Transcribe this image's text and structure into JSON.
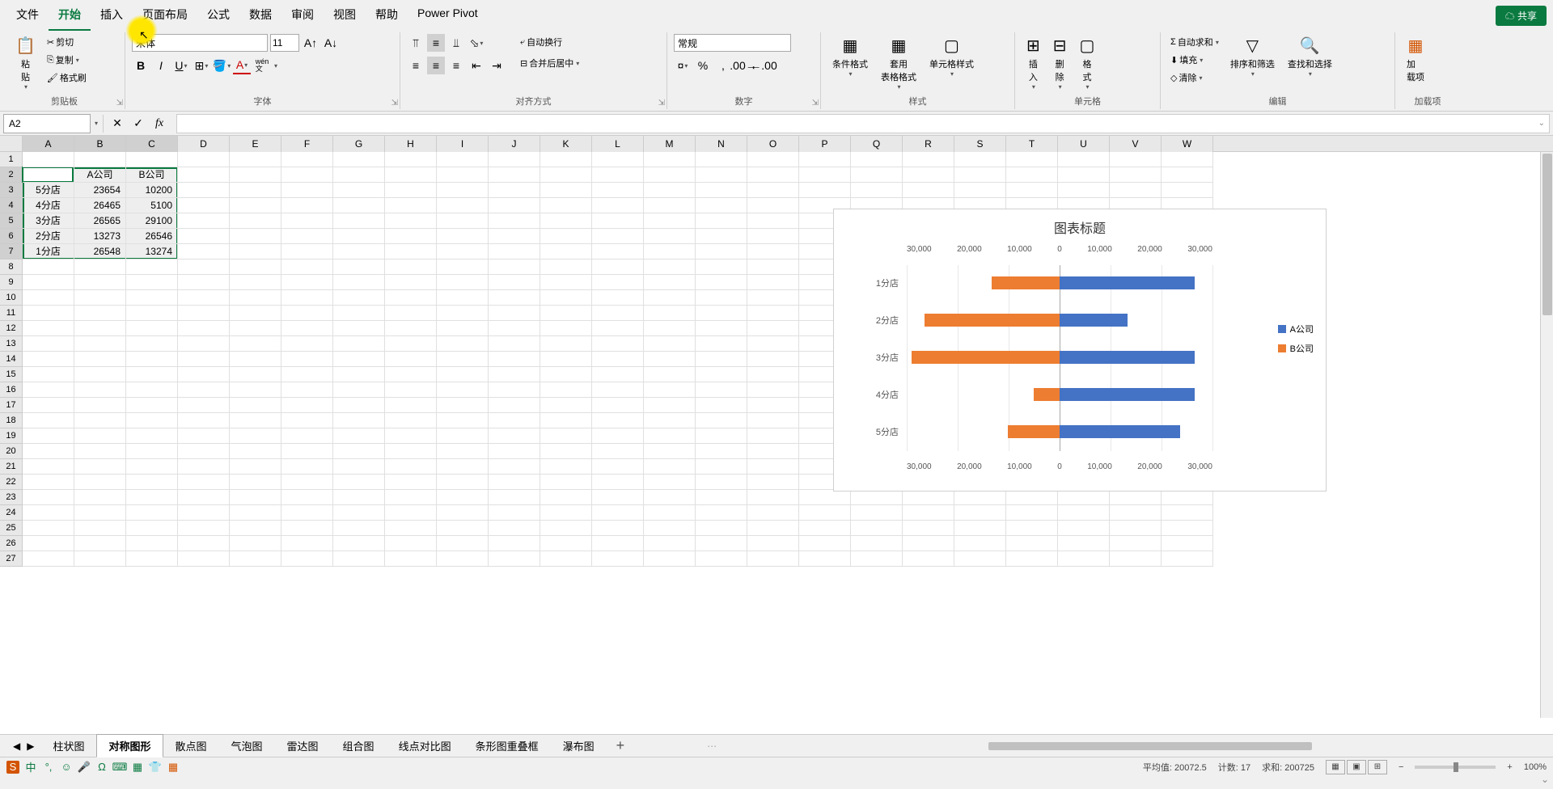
{
  "menu": {
    "items": [
      "文件",
      "开始",
      "插入",
      "页面布局",
      "公式",
      "数据",
      "审阅",
      "视图",
      "帮助",
      "Power Pivot"
    ],
    "active": 1,
    "share": "共享"
  },
  "ribbon": {
    "clipboard": {
      "label": "剪贴板",
      "paste": "粘\n贴",
      "cut": "剪切",
      "copy": "复制",
      "format_painter": "格式刷"
    },
    "font": {
      "label": "字体",
      "name": "宋体",
      "size": "11",
      "wen": "wén\n文"
    },
    "align": {
      "label": "对齐方式",
      "wrap": "自动换行",
      "merge": "合并后居中"
    },
    "number": {
      "label": "数字",
      "format": "常规"
    },
    "styles": {
      "label": "样式",
      "cond": "条件格式",
      "table": "套用\n表格格式",
      "cell": "单元格样式"
    },
    "cells": {
      "label": "单元格",
      "insert": "插\n入",
      "delete": "删\n除",
      "format": "格\n式"
    },
    "editing": {
      "label": "编辑",
      "sum": "自动求和",
      "fill": "填充",
      "clear": "清除",
      "sort": "排序和筛选",
      "find": "查找和选择"
    },
    "addins": {
      "label": "加载项",
      "addin": "加\n载项"
    }
  },
  "formula_bar": {
    "name": "A2"
  },
  "grid": {
    "cols": [
      "A",
      "B",
      "C",
      "D",
      "E",
      "F",
      "G",
      "H",
      "I",
      "J",
      "K",
      "L",
      "M",
      "N",
      "O",
      "P",
      "Q",
      "R",
      "S",
      "T",
      "U",
      "V",
      "W"
    ],
    "rows": 27,
    "data": [
      [
        "",
        "A公司",
        "B公司"
      ],
      [
        "5分店",
        "23654",
        "10200"
      ],
      [
        "4分店",
        "26465",
        "5100"
      ],
      [
        "3分店",
        "26565",
        "29100"
      ],
      [
        "2分店",
        "13273",
        "26546"
      ],
      [
        "1分店",
        "26548",
        "13274"
      ]
    ]
  },
  "chart_data": {
    "type": "bar",
    "title": "图表标题",
    "categories": [
      "1分店",
      "2分店",
      "3分店",
      "4分店",
      "5分店"
    ],
    "series": [
      {
        "name": "A公司",
        "values": [
          26548,
          13273,
          26565,
          26465,
          23654
        ],
        "color": "#4472c4",
        "side": "right"
      },
      {
        "name": "B公司",
        "values": [
          13274,
          26546,
          29100,
          5100,
          10200
        ],
        "color": "#ed7d31",
        "side": "left"
      }
    ],
    "axis_ticks": [
      "30,000",
      "20,000",
      "10,000",
      "0",
      "10,000",
      "20,000",
      "30,000"
    ],
    "xlim": [
      -30000,
      30000
    ]
  },
  "sheets": {
    "tabs": [
      "柱状图",
      "对称图形",
      "散点图",
      "气泡图",
      "雷达图",
      "组合图",
      "线点对比图",
      "条形图重叠框",
      "瀑布图"
    ],
    "active": 1
  },
  "status": {
    "avg_label": "平均值:",
    "avg": "20072.5",
    "count_label": "计数:",
    "count": "17",
    "sum_label": "求和:",
    "sum": "200725",
    "zoom": "100%"
  }
}
